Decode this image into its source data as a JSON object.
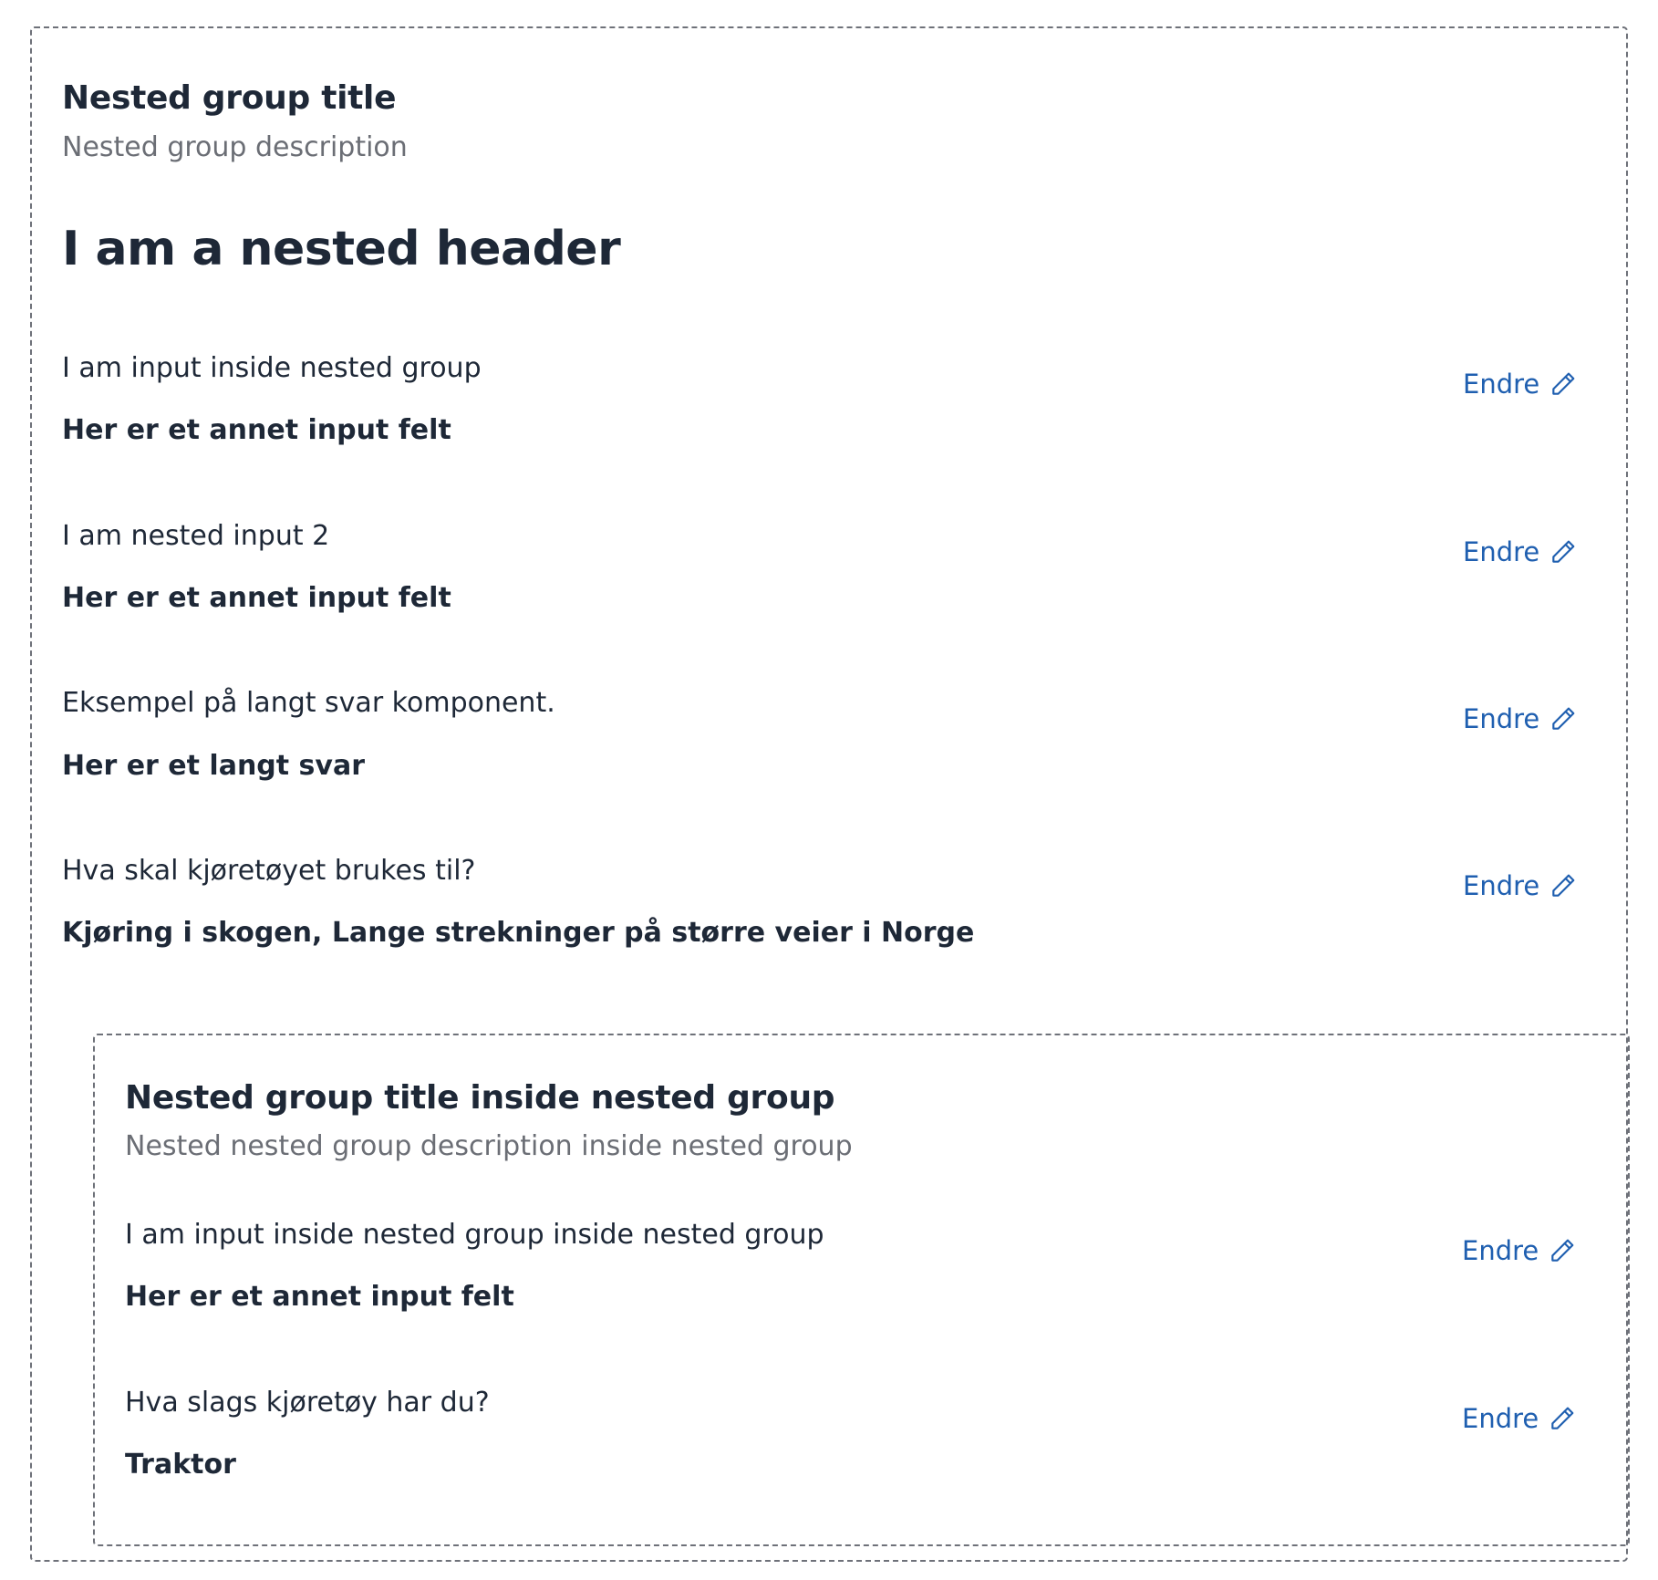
{
  "group": {
    "title": "Nested group title",
    "description": "Nested group description",
    "header": "I am a nested header",
    "items": [
      {
        "label": "I am input inside nested group",
        "answer": "Her er et annet input felt",
        "edit_label": "Endre"
      },
      {
        "label": "I am nested input 2",
        "answer": "Her er et annet input felt",
        "edit_label": "Endre"
      },
      {
        "label": "Eksempel på langt svar komponent.",
        "answer": "Her er et langt svar",
        "edit_label": "Endre"
      },
      {
        "label": "Hva skal kjøretøyet brukes til?",
        "answer": "Kjøring i skogen, Lange strekninger på større veier i Norge",
        "edit_label": "Endre"
      }
    ]
  },
  "nested_group": {
    "title": "Nested group title inside nested group",
    "description": "Nested nested group description inside nested group",
    "items": [
      {
        "label": "I am input inside nested group inside nested group",
        "answer": "Her er et annet input felt",
        "edit_label": "Endre"
      },
      {
        "label": "Hva slags kjøretøy har du?",
        "answer": "Traktor",
        "edit_label": "Endre"
      }
    ]
  },
  "icons": {
    "edit": "pencil-icon"
  },
  "colors": {
    "link": "#1f5fb0",
    "text": "#1e2837",
    "muted": "#6b6e75",
    "border": "#6e7179"
  }
}
